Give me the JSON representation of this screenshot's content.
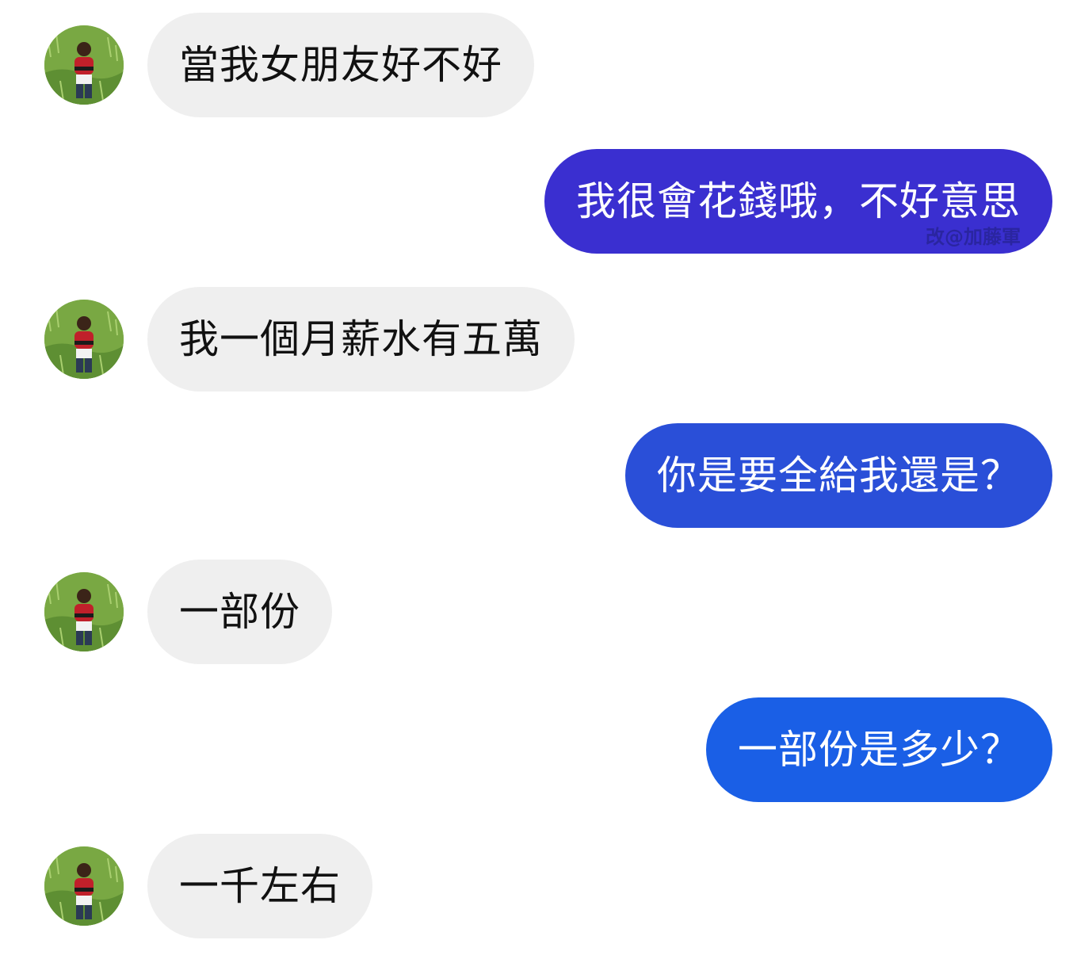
{
  "colors": {
    "incoming_bubble": "#efefef",
    "incoming_text": "#111111",
    "outgoing_text": "#ffffff",
    "outgoing_1": "#3a2fd0",
    "outgoing_2": "#2a4fd8",
    "outgoing_3": "#1a5fe6"
  },
  "avatar": {
    "icon": "profile-photo-icon"
  },
  "messages": [
    {
      "side": "in",
      "text": "當我女朋友好不好"
    },
    {
      "side": "out",
      "text": "我很會花錢哦，不好意思",
      "watermark": "改@加藤軍"
    },
    {
      "side": "in",
      "text": "我一個月薪水有五萬"
    },
    {
      "side": "out",
      "text": "你是要全給我還是？"
    },
    {
      "side": "in",
      "text": "一部份"
    },
    {
      "side": "out",
      "text": "一部份是多少？"
    },
    {
      "side": "in",
      "text": "一千左右"
    }
  ]
}
